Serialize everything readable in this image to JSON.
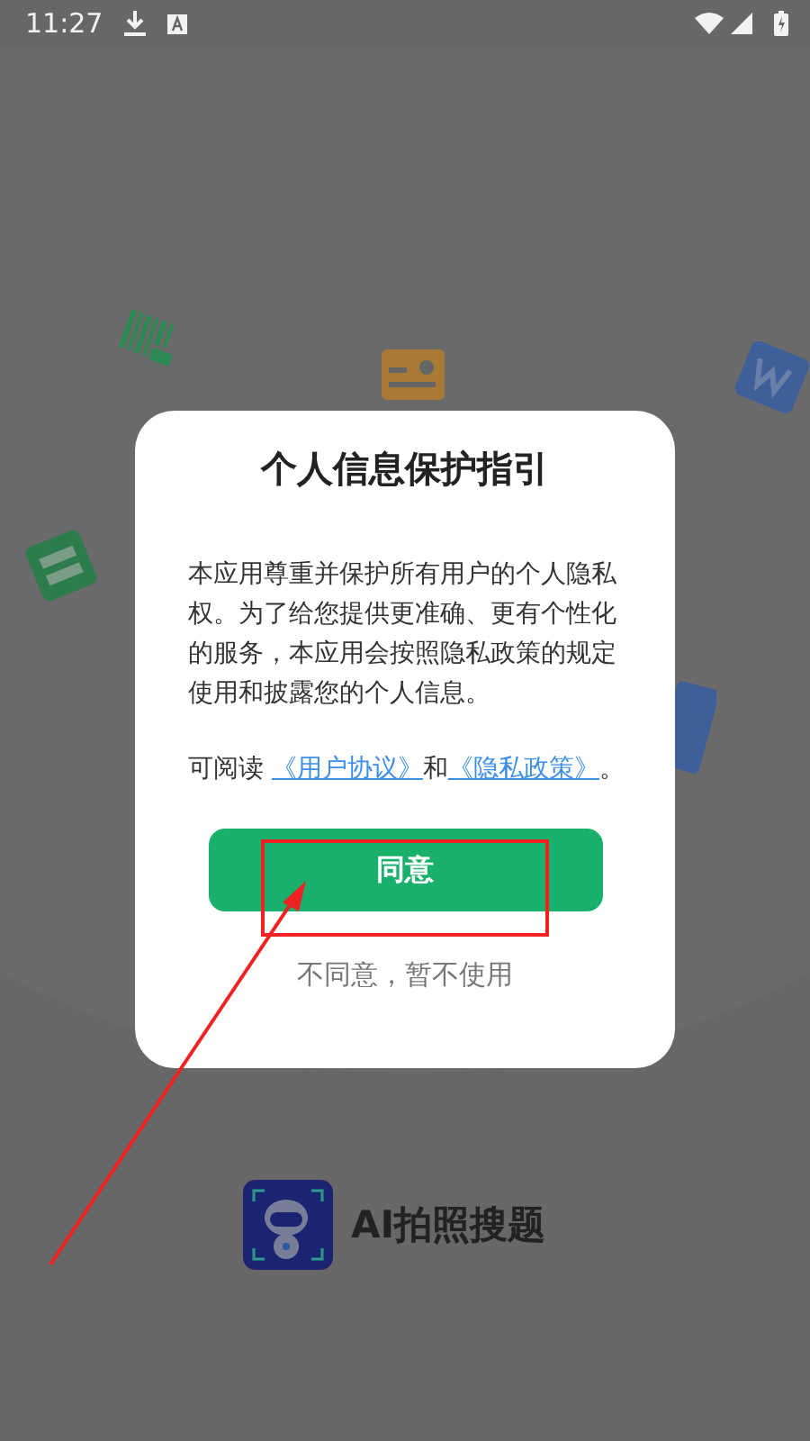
{
  "status_bar": {
    "time": "11:27"
  },
  "dialog": {
    "title": "个人信息保护指引",
    "body": "本应用尊重并保护所有用户的个人隐私权。为了给您提供更准确、更有个性化的服务，本应用会按照隐私政策的规定使用和披露您的个人信息。",
    "consent_line": [
      {
        "kind": "text",
        "text": "可阅读 "
      },
      {
        "kind": "link",
        "text": "《用户协议》"
      },
      {
        "kind": "text",
        "text": "和"
      },
      {
        "kind": "link",
        "text": "《隐私政策》"
      },
      {
        "kind": "text",
        "text": "。"
      }
    ],
    "agree_button": "同意",
    "decline_button": "不同意，暂不使用"
  },
  "app": {
    "name": "AI拍照搜题"
  },
  "annotations": {
    "highlight_box": true,
    "pointer_arrow": true
  }
}
